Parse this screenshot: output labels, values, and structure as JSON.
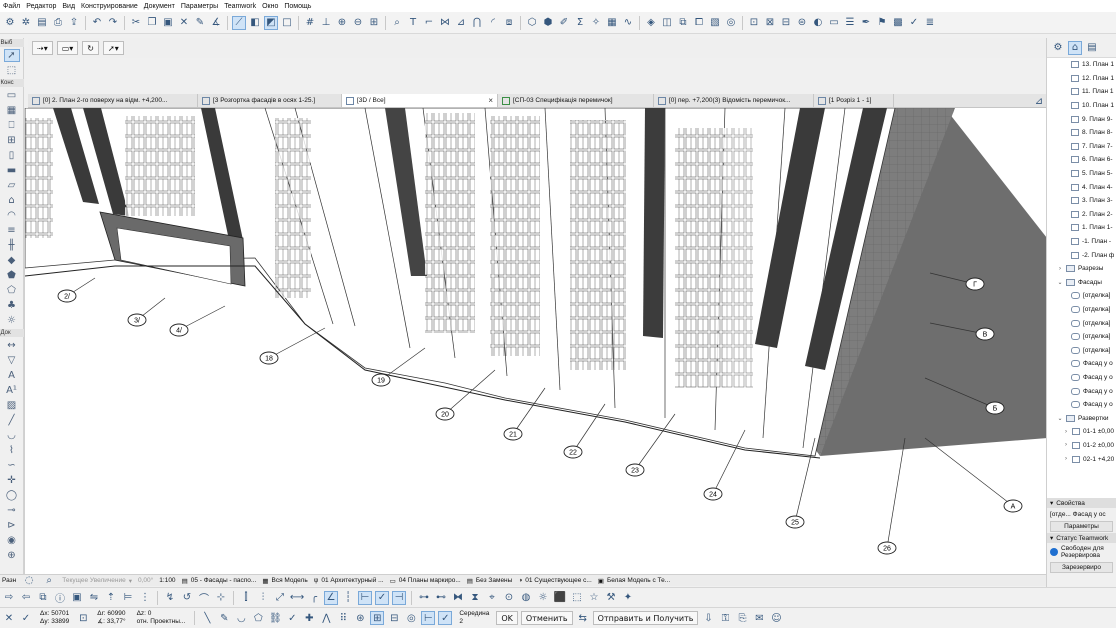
{
  "menu": [
    "Файл",
    "Редактор",
    "Вид",
    "Конструирование",
    "Документ",
    "Параметры",
    "Teamwork",
    "Окно",
    "Помощь"
  ],
  "toolbox": {
    "label_select": "Выб",
    "label_construct": "Конс",
    "label_document": "Док"
  },
  "tabs": [
    {
      "label": "[0] 2. План 2-го поверху на відм. +4,200..."
    },
    {
      "label": "[3 Розгортка фасадів в осях 1-25.]"
    },
    {
      "label": "[3D / Все]",
      "close": "×"
    },
    {
      "label": "[СП-03 Специфікація перемичок]"
    },
    {
      "label": "[0] пер. +7,200(3) Відомість перемичок..."
    },
    {
      "label": "[1 Розріз 1 - 1]"
    }
  ],
  "axis_labels": [
    "2/",
    "3/",
    "4/",
    "18",
    "19",
    "20",
    "21",
    "22",
    "23",
    "24",
    "25",
    "26",
    "A",
    "Б",
    "В",
    "Г"
  ],
  "statusbar": {
    "raz": "Разн",
    "zoom": "Текущее Увеличение",
    "angle": "0,00°",
    "scale": "1:100",
    "layer_combo": "05 - Фасады - паспо...",
    "model": "Вся Модель",
    "pen_set": "01 Архитектурный ...",
    "view_map": "04 Планы маркиро...",
    "renov": "Без Замены",
    "existing": "01 Существующее с...",
    "model_style": "Белая Модель с Те..."
  },
  "coords": {
    "ax": "Δx: 50701",
    "ay": "Δy: 33899",
    "ar": "Δr: 60990",
    "angle": "∡: 33,77°",
    "az": "Δz: 0",
    "ref": "отн. Проектны...",
    "center": "Середина",
    "center_val": "2"
  },
  "infobox": {
    "ok": "OK",
    "cancel": "Отменить",
    "send": "Отправить и Получить"
  },
  "navigator": {
    "items": [
      {
        "label": "13. План 1",
        "type": "page"
      },
      {
        "label": "12. План 1",
        "type": "page"
      },
      {
        "label": "11. План 1",
        "type": "page"
      },
      {
        "label": "10. План 1",
        "type": "page"
      },
      {
        "label": "9. План 9-",
        "type": "page"
      },
      {
        "label": "8. План 8-",
        "type": "page"
      },
      {
        "label": "7. План 7-",
        "type": "page"
      },
      {
        "label": "6. План 6-",
        "type": "page"
      },
      {
        "label": "5. План 5-",
        "type": "page"
      },
      {
        "label": "4. План 4-",
        "type": "page"
      },
      {
        "label": "3. План 3-",
        "type": "page"
      },
      {
        "label": "2. План 2-",
        "type": "page"
      },
      {
        "label": "1. План 1-",
        "type": "page"
      },
      {
        "label": "-1. План -",
        "type": "page"
      },
      {
        "label": "-2. План ф",
        "type": "page"
      },
      {
        "label": "Разрезы",
        "type": "folder",
        "arrow": "›"
      },
      {
        "label": "Фасады",
        "type": "folder",
        "arrow": "⌄"
      },
      {
        "label": "[отделка]",
        "type": "elev"
      },
      {
        "label": "[отделка]",
        "type": "elev"
      },
      {
        "label": "[отделка]",
        "type": "elev"
      },
      {
        "label": "[отделка]",
        "type": "elev"
      },
      {
        "label": "[отделка]",
        "type": "elev"
      },
      {
        "label": "Фасад у о",
        "type": "elev"
      },
      {
        "label": "Фасад у о",
        "type": "elev"
      },
      {
        "label": "Фасад у о",
        "type": "elev"
      },
      {
        "label": "Фасад у о",
        "type": "elev"
      },
      {
        "label": "Развертки",
        "type": "folder",
        "arrow": "⌄"
      },
      {
        "label": "01-1 ±0,00",
        "type": "sub",
        "arrow": "›"
      },
      {
        "label": "01-2 ±0,00",
        "type": "sub",
        "arrow": "›"
      },
      {
        "label": "02-1 +4,20",
        "type": "sub",
        "arrow": "›"
      }
    ]
  },
  "properties": {
    "title": "Свойства",
    "selected": "[отде... Фасад у ос",
    "params_button": "Параметры",
    "teamwork_title": "Статус Teamwork",
    "teamwork_status": "Свободен для Резервирова",
    "reserve_button": "Зарезервиро"
  },
  "colors": {
    "accent": "#2f6fb4",
    "tab_active": "#ffffff",
    "teamwork_dot": "#1f6fd0"
  }
}
